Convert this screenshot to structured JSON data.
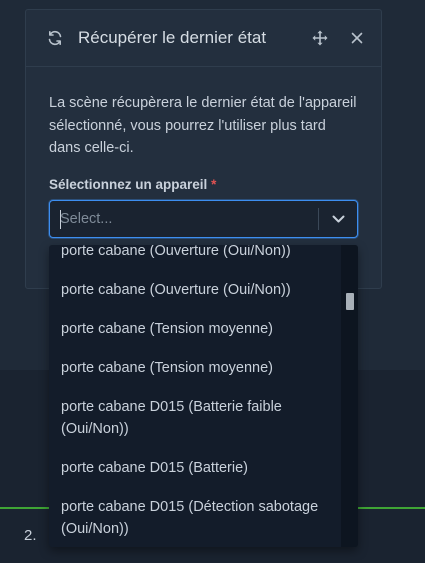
{
  "modal": {
    "title": "Récupérer le dernier état",
    "description": "La scène récupèrera le dernier état de l'appareil sélectionné, vous pourrez l'utiliser plus tard dans celle-ci.",
    "field_label": "Sélectionnez un appareil",
    "required_marker": "*"
  },
  "select": {
    "placeholder": "Select...",
    "value": ""
  },
  "dropdown": {
    "options": [
      "porte cabane (Ouverture (Oui/Non))",
      "porte cabane (Ouverture (Oui/Non))",
      "porte cabane (Tension moyenne)",
      "porte cabane (Tension moyenne)",
      "porte cabane D015 (Batterie faible (Oui/Non))",
      "porte cabane D015 (Batterie)",
      "porte cabane D015 (Détection sabotage (Oui/Non))"
    ]
  },
  "background": {
    "step_number": "2."
  },
  "colors": {
    "accent": "#3d8ef0",
    "required": "#e05252",
    "success_line": "#3fa535"
  }
}
